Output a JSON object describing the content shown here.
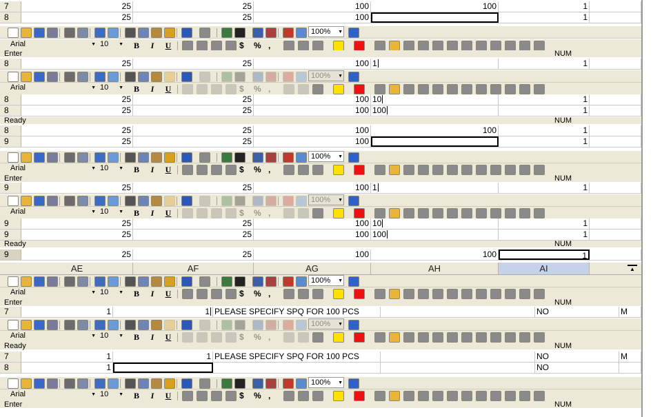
{
  "font_name": "Arial",
  "font_size": "10",
  "zoom": "100%",
  "status_num": "NUM",
  "column_headers": [
    "AE",
    "AF",
    "AG",
    "AH",
    "AI"
  ],
  "selected_column": "AI",
  "colors": {
    "face": "#ece9d8",
    "font_color": "#e11",
    "fill_color": "#ffe000"
  },
  "rows": {
    "r7a": {
      "num": "7",
      "c1": "25",
      "c2": "25",
      "c3": "100",
      "c4": "100",
      "c5": "1"
    },
    "r8a": {
      "num": "8",
      "c1": "25",
      "c2": "25",
      "c3": "100",
      "c4": "",
      "c5": "1"
    },
    "status1": "Enter",
    "r8b": {
      "num": "8",
      "c1": "25",
      "c2": "25",
      "c3": "100",
      "c4": "1",
      "c5": "1"
    },
    "r8c": {
      "num": "8",
      "c1": "25",
      "c2": "25",
      "c3": "100",
      "c4": "10",
      "c5": "1"
    },
    "r8d": {
      "num": "8",
      "c1": "25",
      "c2": "25",
      "c3": "100",
      "c4": "100",
      "c5": "1"
    },
    "status2": "Ready",
    "r8e": {
      "num": "8",
      "c1": "25",
      "c2": "25",
      "c3": "100",
      "c4": "100",
      "c5": "1"
    },
    "r9a": {
      "num": "9",
      "c1": "25",
      "c2": "25",
      "c3": "100",
      "c4": "",
      "c5": "1"
    },
    "status3": "Enter",
    "r9b": {
      "num": "9",
      "c1": "25",
      "c2": "25",
      "c3": "100",
      "c4": "1",
      "c5": "1"
    },
    "r9c": {
      "num": "9",
      "c1": "25",
      "c2": "25",
      "c3": "100",
      "c4": "10",
      "c5": "1"
    },
    "r9d": {
      "num": "9",
      "c1": "25",
      "c2": "25",
      "c3": "100",
      "c4": "100",
      "c5": "1"
    },
    "status4": "Ready",
    "r9e": {
      "num": "9",
      "c1": "25",
      "c2": "25",
      "c3": "100",
      "c4": "100",
      "c5": "1"
    },
    "status5": "Enter",
    "r7b": {
      "num": "7",
      "c1": "1",
      "c2": "1",
      "c3": "PLEASE SPECIFY SPQ FOR 100 PCS",
      "c4": "",
      "c5": "NO",
      "c6": "M"
    },
    "status6": "Ready",
    "r7c": {
      "num": "7",
      "c1": "1",
      "c2": "1",
      "c3": "PLEASE SPECIFY SPQ FOR 100 PCS",
      "c4": "",
      "c5": "NO",
      "c6": "M"
    },
    "r8f": {
      "num": "8",
      "c1": "1",
      "c2": "",
      "c3": "",
      "c4": "",
      "c5": "NO",
      "c6": ""
    },
    "status7": "Enter"
  }
}
